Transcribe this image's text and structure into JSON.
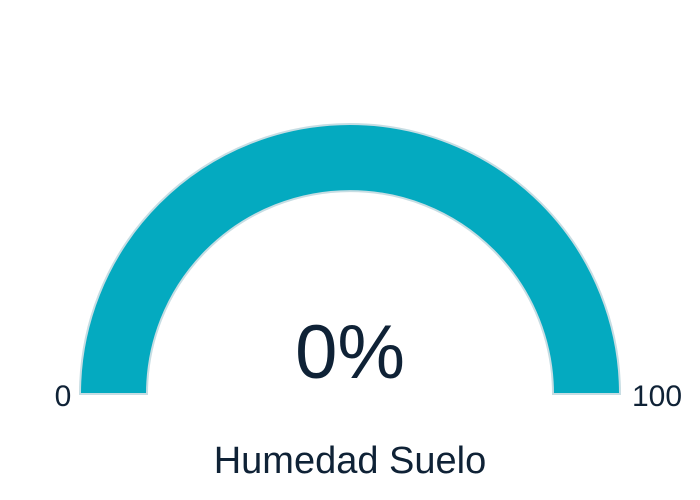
{
  "chart_data": {
    "type": "gauge",
    "title": "Humedad Suelo",
    "value": 0,
    "value_display": "0%",
    "min": 0,
    "max": 100,
    "min_label": "0",
    "max_label": "100",
    "colors": {
      "track": "#04aac0",
      "track_stroke": "#c7dde3",
      "text": "#0f2236"
    }
  }
}
